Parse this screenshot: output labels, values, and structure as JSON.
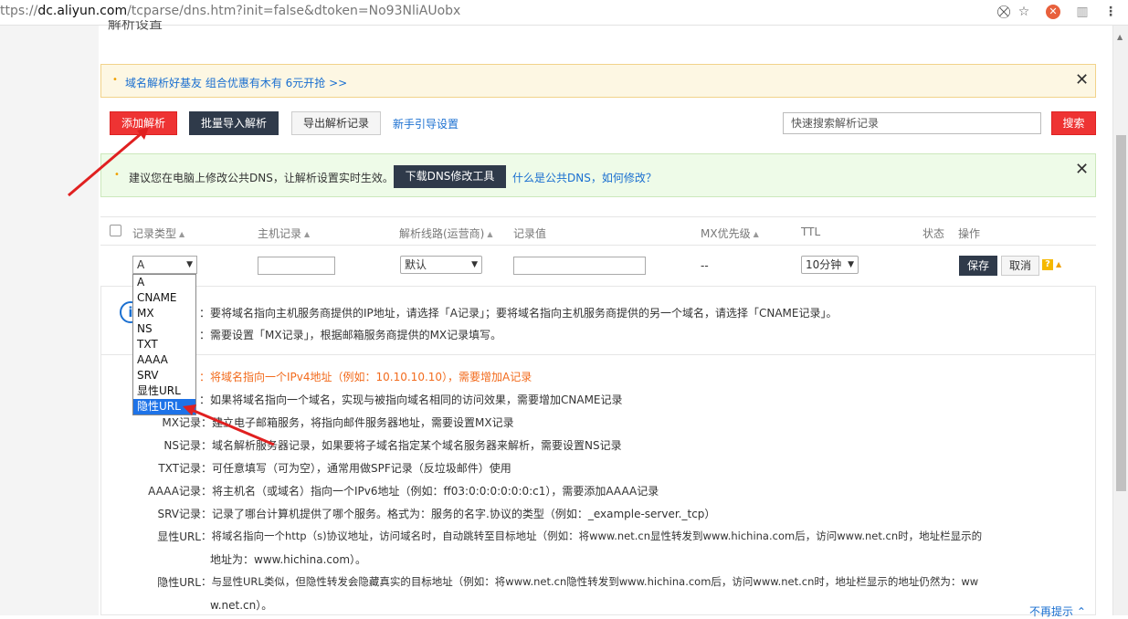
{
  "browser": {
    "url_proto": "ttps://",
    "url_host": "dc.aliyun.com",
    "url_path": "/tcparse/dns.htm?init=false&dtoken=No93NliAUobx"
  },
  "heading_cut": "解析设置",
  "banner": {
    "text": "域名解析好基友 组合优惠有木有 6元开抢 >>"
  },
  "toolbar": {
    "add": "添加解析",
    "batch_import": "批量导入解析",
    "export": "导出解析记录",
    "guide": "新手引导设置",
    "search_placeholder": "快速搜索解析记录",
    "search_btn": "搜索"
  },
  "tip": {
    "text": "建议您在电脑上修改公共DNS，让解析设置实时生效。",
    "download_btn": "下载DNS修改工具",
    "link": "什么是公共DNS，如何修改？"
  },
  "table": {
    "headers": [
      "记录类型",
      "主机记录",
      "解析线路(运营商)",
      "记录值",
      "MX优先级",
      "TTL",
      "状态",
      "操作"
    ]
  },
  "edit_row": {
    "type_value": "A",
    "line_value": "默认",
    "mx_value": "--",
    "ttl_value": "10分钟",
    "save": "保存",
    "cancel": "取消",
    "help": "?"
  },
  "dropdown_options": [
    "A",
    "CNAME",
    "MX",
    "NS",
    "TXT",
    "AAAA",
    "SRV",
    "显性URL",
    "隐性URL"
  ],
  "dropdown_selected": "隐性URL",
  "info_top": [
    "：要将域名指向主机服务商提供的IP地址，请选择「A记录」；要将域名指向主机服务商提供的另一个域名，请选择「CNAME记录」。",
    "：需要设置「MX记录」，根据邮箱服务商提供的MX记录填写。"
  ],
  "info_rows": [
    {
      "label": "",
      "text": "：将域名指向一个IPv4地址（例如：10.10.10.10），需要增加A记录"
    },
    {
      "label": "",
      "text": "：如果将域名指向一个域名，实现与被指向域名相同的访问效果，需要增加CNAME记录"
    },
    {
      "label": "MX记录",
      "text": "：建立电子邮箱服务，将指向邮件服务器地址，需要设置MX记录"
    },
    {
      "label": "NS记录",
      "text": "：域名解析服务器记录，如果要将子域名指定某个域名服务器来解析，需要设置NS记录"
    },
    {
      "label": "TXT记录",
      "text": "：可任意填写（可为空），通常用做SPF记录（反垃圾邮件）使用"
    },
    {
      "label": "AAAA记录",
      "text": "：将主机名（或域名）指向一个IPv6地址（例如：ff03:0:0:0:0:0:0:c1），需要添加AAAA记录"
    },
    {
      "label": "SRV记录",
      "text": "：记录了哪台计算机提供了哪个服务。格式为：服务的名字.协议的类型（例如：_example-server._tcp）"
    },
    {
      "label": "显性URL",
      "text": "：将域名指向一个http（s)协议地址，访问域名时，自动跳转至目标地址（例如：将www.net.cn显性转发到www.hichina.com后，访问www.net.cn时，地址栏显示的"
    },
    {
      "label": "",
      "text": "地址为：www.hichina.com）。"
    },
    {
      "label": "隐性URL",
      "text": "：与显性URL类似，但隐性转发会隐藏真实的目标地址（例如：将www.net.cn隐性转发到www.hichina.com后，访问www.net.cn时，地址栏显示的地址仍然为：ww"
    },
    {
      "label": "",
      "text": "w.net.cn）。"
    }
  ],
  "no_more_tips": "不再提示",
  "colors": {
    "accent_red": "#ee3333",
    "dark_btn": "#2f3a4a",
    "link_blue": "#1a6fd0",
    "selected_blue": "#1e73e8",
    "arrow_red": "#e02020"
  }
}
